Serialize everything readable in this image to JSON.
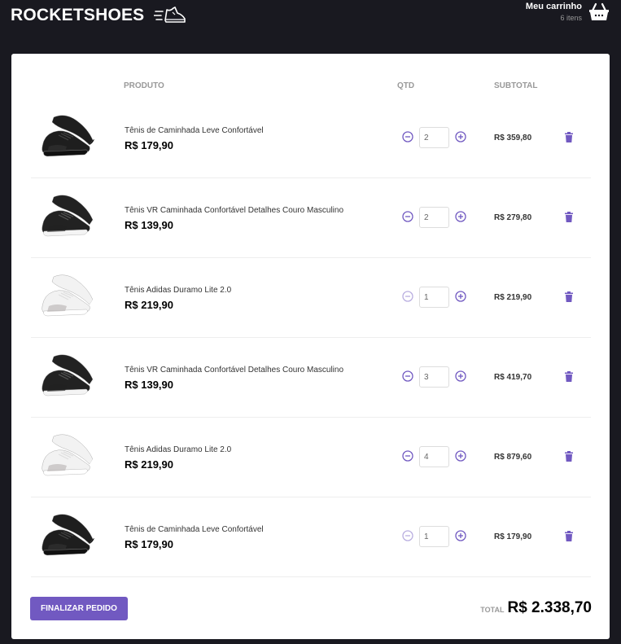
{
  "header": {
    "logo_text": "ROCKETSHOES",
    "cart_title": "Meu carrinho",
    "cart_count": "6 itens"
  },
  "table": {
    "col_product": "PRODUTO",
    "col_qty": "QTD",
    "col_subtotal": "SUBTOTAL"
  },
  "items": [
    {
      "title": "Tênis de Caminhada Leve Confortável",
      "price": "R$ 179,90",
      "amount": "2",
      "subtotal": "R$ 359,80",
      "shoe_color": "black",
      "decrement_enabled": true
    },
    {
      "title": "Tênis VR Caminhada Confortável Detalhes Couro Masculino",
      "price": "R$ 139,90",
      "amount": "2",
      "subtotal": "R$ 279,80",
      "shoe_color": "black-white",
      "decrement_enabled": true
    },
    {
      "title": "Tênis Adidas Duramo Lite 2.0",
      "price": "R$ 219,90",
      "amount": "1",
      "subtotal": "R$ 219,90",
      "shoe_color": "white",
      "decrement_enabled": false
    },
    {
      "title": "Tênis VR Caminhada Confortável Detalhes Couro Masculino",
      "price": "R$ 139,90",
      "amount": "3",
      "subtotal": "R$ 419,70",
      "shoe_color": "black-white",
      "decrement_enabled": true
    },
    {
      "title": "Tênis Adidas Duramo Lite 2.0",
      "price": "R$ 219,90",
      "amount": "4",
      "subtotal": "R$ 879,60",
      "shoe_color": "white",
      "decrement_enabled": true
    },
    {
      "title": "Tênis de Caminhada Leve Confortável",
      "price": "R$ 179,90",
      "amount": "1",
      "subtotal": "R$ 179,90",
      "shoe_color": "black",
      "decrement_enabled": false
    }
  ],
  "footer": {
    "checkout_label": "Finalizar pedido",
    "total_label": "TOTAL",
    "total_value": "R$ 2.338,70"
  },
  "colors": {
    "accent": "#7159c1",
    "background": "#191920",
    "card": "#ffffff"
  }
}
